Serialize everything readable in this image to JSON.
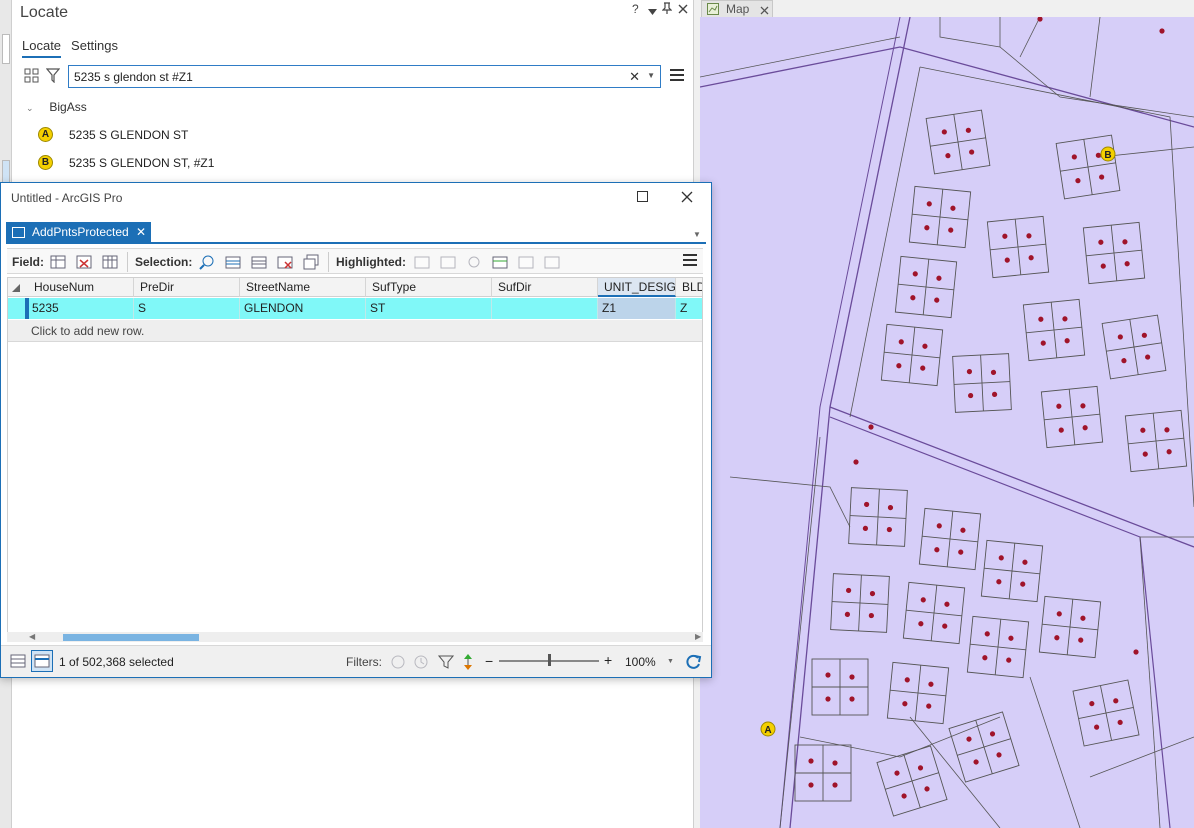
{
  "locate": {
    "title": "Locate",
    "help": "?",
    "tabs": [
      "Locate",
      "Settings"
    ],
    "search_value": "5235 s glendon st #Z1",
    "clear_glyph": "✕",
    "drop_glyph": "▼",
    "group_name": "BigAss",
    "results": [
      {
        "marker": "A",
        "label": "5235 S GLENDON ST"
      },
      {
        "marker": "B",
        "label": "5235 S GLENDON ST, #Z1"
      }
    ]
  },
  "map": {
    "tab_label": "Map",
    "background_color": "#d6cef8",
    "markers": [
      "A",
      "B"
    ]
  },
  "table_window": {
    "title": "Untitled - ArcGIS Pro",
    "tab_label": "AddPntsProtected",
    "toolbar": {
      "field_label": "Field:",
      "selection_label": "Selection:",
      "highlighted_label": "Highlighted:"
    },
    "columns": [
      "HouseNum",
      "PreDir",
      "StreetName",
      "SufType",
      "SufDir",
      "UNIT_DESIG",
      "BLD"
    ],
    "rows": [
      [
        "5235",
        "S",
        "GLENDON",
        "ST",
        "",
        "Z1",
        "Z"
      ]
    ],
    "add_row_text": "Click to add new row.",
    "status": {
      "selected_text": "1 of 502,368 selected",
      "filters_label": "Filters:",
      "zoom_minus": "−",
      "zoom_plus": "+",
      "zoom_level": "100%"
    }
  },
  "colors": {
    "accent": "#1c6fb6",
    "selected_row": "#80f8f8",
    "marker_yellow": "#f4d000",
    "parcel_line": "#6a4b9a"
  }
}
